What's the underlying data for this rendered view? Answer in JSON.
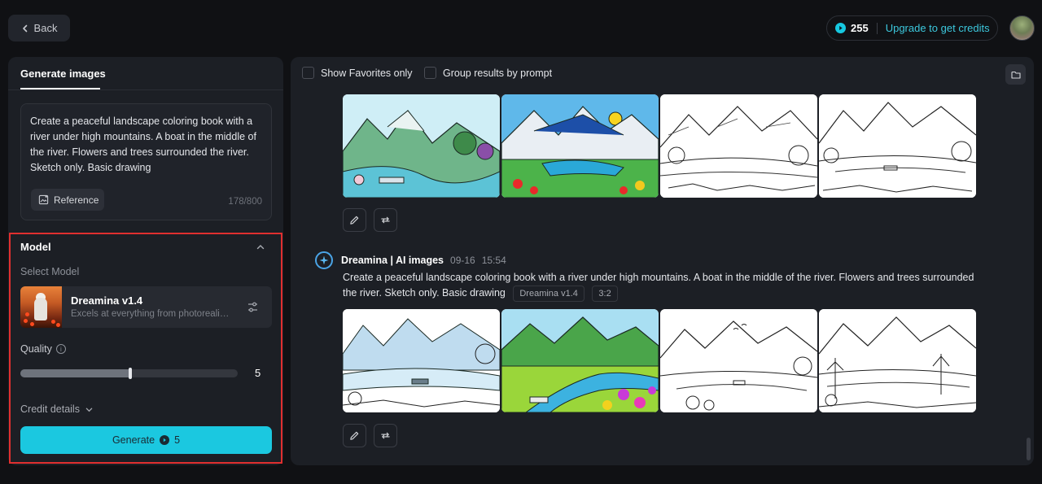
{
  "header": {
    "back_label": "Back",
    "credits_count": "255",
    "upgrade_label": "Upgrade to get credits"
  },
  "left_panel": {
    "tab_label": "Generate images",
    "prompt_text": "Create a peaceful landscape coloring book with a river under high mountains. A boat in the middle of the river. Flowers and trees surrounded the river. Sketch only. Basic drawing",
    "reference_label": "Reference",
    "char_count": "178/800",
    "model": {
      "section_title": "Model",
      "select_label": "Select Model",
      "name": "Dreamina v1.4",
      "description": "Excels at everything from photorealism to painterly styles",
      "quality_label": "Quality",
      "quality_value": "5",
      "quality_fraction": 0.5,
      "credit_details_label": "Credit details",
      "generate_label": "Generate",
      "generate_cost": "5"
    }
  },
  "right_panel": {
    "show_favorites_label": "Show Favorites only",
    "group_results_label": "Group results by prompt",
    "generation": {
      "author": "Dreamina | AI images",
      "date": "09-16",
      "time": "15:54",
      "prompt": "Create a peaceful landscape coloring book with a river under high mountains. A boat in the middle of the river. Flowers and trees surrounded the river. Sketch only. Basic drawing",
      "model_tag": "Dreamina v1.4",
      "ratio_tag": "3:2"
    }
  },
  "colors": {
    "accent": "#1bc8e0",
    "highlight_border": "#e02f2f",
    "panel_bg": "#1c1f25",
    "page_bg": "#101114"
  }
}
